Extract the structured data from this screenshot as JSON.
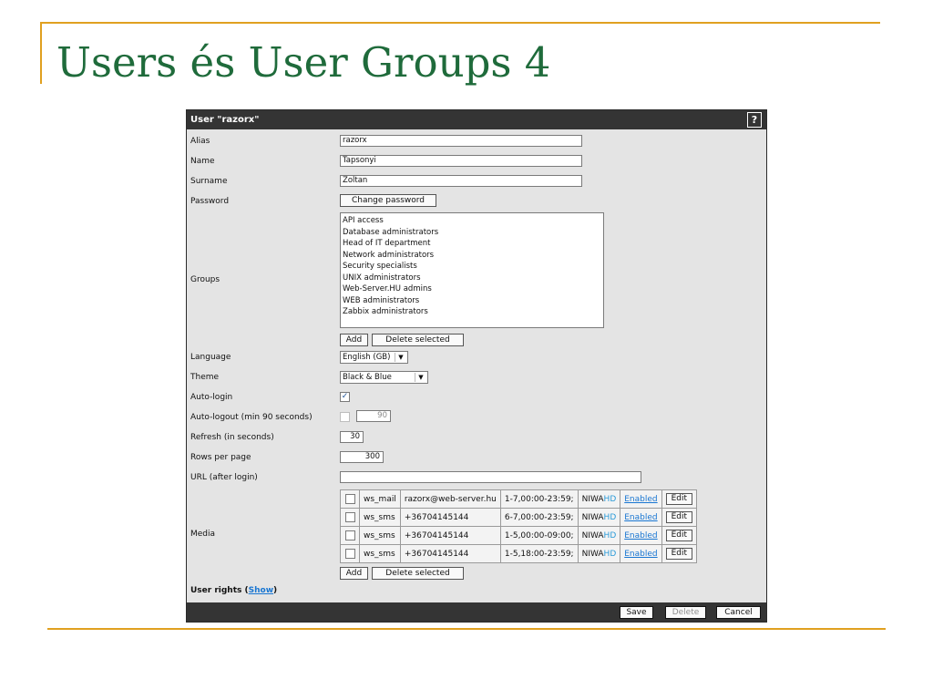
{
  "slide": {
    "title": "Users és User Groups 4"
  },
  "form": {
    "title": "User \"razorx\"",
    "help_label": "?",
    "labels": {
      "alias": "Alias",
      "name": "Name",
      "surname": "Surname",
      "password": "Password",
      "groups": "Groups",
      "language": "Language",
      "theme": "Theme",
      "autologin": "Auto-login",
      "autologout": "Auto-logout (min 90 seconds)",
      "refresh": "Refresh (in seconds)",
      "rows": "Rows per page",
      "url": "URL (after login)",
      "media": "Media"
    },
    "alias": "razorx",
    "name": "Tapsonyi",
    "surname": "Zoltan",
    "change_password": "Change password",
    "groups": [
      "API access",
      "Database administrators",
      "Head of IT department",
      "Network administrators",
      "Security specialists",
      "UNIX administrators",
      "Web-Server.HU admins",
      "WEB administrators",
      "Zabbix administrators"
    ],
    "add": "Add",
    "delete_selected": "Delete selected",
    "language": "English (GB)",
    "theme": "Black & Blue",
    "autologin_checked": true,
    "autologout_checked": false,
    "autologout_value": "90",
    "refresh": "30",
    "rows_per_page": "300",
    "url": "",
    "media": [
      {
        "type": "ws_mail",
        "sendto": "razorx@web-server.hu",
        "period": "1-7,00:00-23:59;",
        "sev_off": "NIWA",
        "sev_on": "HD",
        "status": "Enabled",
        "edit": "Edit"
      },
      {
        "type": "ws_sms",
        "sendto": "+36704145144",
        "period": "6-7,00:00-23:59;",
        "sev_off": "NIWA",
        "sev_on": "HD",
        "status": "Enabled",
        "edit": "Edit"
      },
      {
        "type": "ws_sms",
        "sendto": "+36704145144",
        "period": "1-5,00:00-09:00;",
        "sev_off": "NIWA",
        "sev_on": "HD",
        "status": "Enabled",
        "edit": "Edit"
      },
      {
        "type": "ws_sms",
        "sendto": "+36704145144",
        "period": "1-5,18:00-23:59;",
        "sev_off": "NIWA",
        "sev_on": "HD",
        "status": "Enabled",
        "edit": "Edit"
      }
    ],
    "user_rights_label": "User rights",
    "user_rights_open": "(",
    "user_rights_show": "Show",
    "user_rights_close": ")",
    "save": "Save",
    "delete": "Delete",
    "cancel": "Cancel"
  },
  "colors": {
    "accent": "#e0a020",
    "title": "#1f6b3b",
    "header": "#343434",
    "link": "#1976d2",
    "severity_on": "#2a9ad8"
  }
}
